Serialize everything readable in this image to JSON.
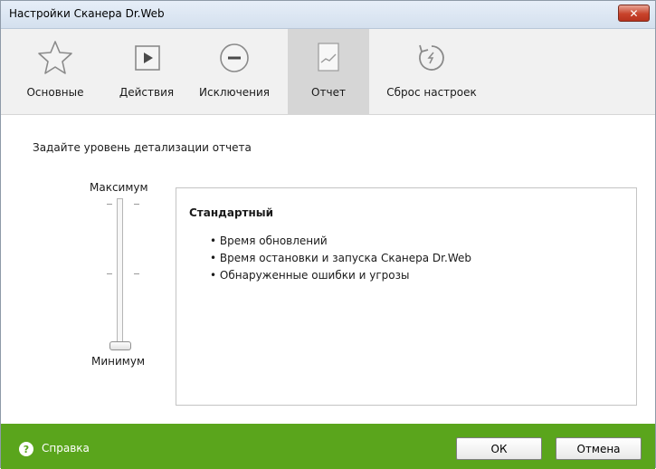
{
  "window": {
    "title": "Настройки Сканера Dr.Web",
    "close_glyph": "✕"
  },
  "tabs": [
    {
      "label": "Основные",
      "icon": "star-icon"
    },
    {
      "label": "Действия",
      "icon": "play-icon"
    },
    {
      "label": "Исключения",
      "icon": "minus-circle-icon"
    },
    {
      "label": "Отчет",
      "icon": "report-icon",
      "active": true
    },
    {
      "label": "Сброс настроек",
      "icon": "reset-icon"
    }
  ],
  "report": {
    "instruction": "Задайте уровень детализации отчета",
    "slider": {
      "max_label": "Максимум",
      "min_label": "Минимум",
      "level": 0
    },
    "level_title": "Стандартный",
    "bullets": [
      "Время обновлений",
      "Время остановки и запуска Сканера Dr.Web",
      "Обнаруженные ошибки и угрозы"
    ]
  },
  "footer": {
    "help_label": "Справка",
    "help_icon_glyph": "?",
    "ok_label": "ОК",
    "cancel_label": "Отмена"
  },
  "colors": {
    "footer": "#5aa51c",
    "active_tab": "#d6d6d6",
    "close": "#c8432b"
  }
}
